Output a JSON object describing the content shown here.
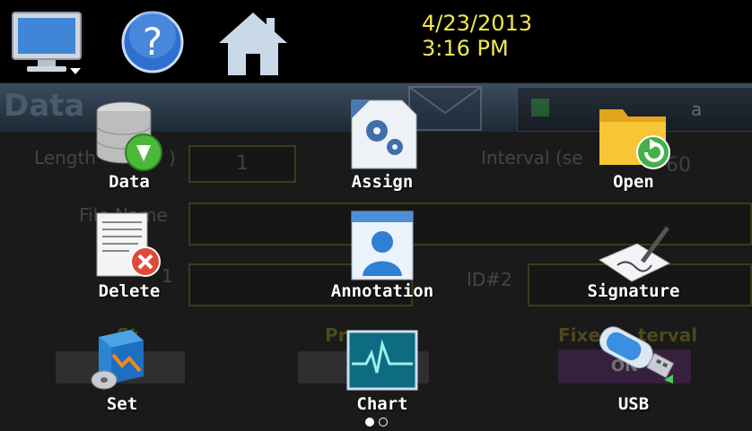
{
  "status": {
    "date": "4/23/2013",
    "time": "3:16 PM"
  },
  "background": {
    "title": "Data",
    "status_label": "a",
    "length_label": "Length",
    "length_paren": ")",
    "length_value": "1",
    "interval_label": "Interval (se",
    "interval_value": "60",
    "filename_label": "File Name",
    "id1_label": "1",
    "id2_label": "ID#2",
    "start_label": "St",
    "pressure_label": "Pr",
    "fixed_interval_label": "Fixe      terval",
    "fixed_interval_value": "ON"
  },
  "menu": {
    "items": [
      {
        "label": "Data",
        "icon": "database-download-icon"
      },
      {
        "label": "Assign",
        "icon": "gears-document-icon"
      },
      {
        "label": "Open",
        "icon": "folder-refresh-icon"
      },
      {
        "label": "Delete",
        "icon": "document-delete-icon"
      },
      {
        "label": "Annotation",
        "icon": "text-person-icon"
      },
      {
        "label": "Signature",
        "icon": "pen-paper-icon"
      },
      {
        "label": "Set",
        "icon": "install-box-icon"
      },
      {
        "label": "Chart",
        "icon": "chart-monitor-icon"
      },
      {
        "label": "USB",
        "icon": "usb-drive-icon"
      }
    ]
  },
  "pager": {
    "pages": 2,
    "current": 1
  },
  "colors": {
    "accent_text": "#f1e94a",
    "field_border": "#6b6020",
    "on_pill": "#5a2a6a"
  }
}
